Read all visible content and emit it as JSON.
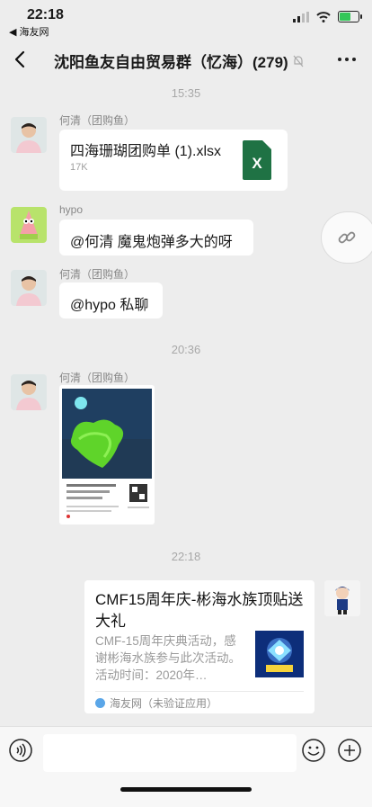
{
  "status": {
    "time": "22:18",
    "back_app": "◀ 海友网"
  },
  "nav": {
    "title": "沈阳鱼友自由贸易群（忆海）(279)"
  },
  "messages": {
    "ts1": "15:35",
    "ts2": "20:36",
    "ts3": "22:18",
    "m1_sender": "何清（团购鱼）",
    "m1_file_name": "四海珊瑚团购单 (1).xlsx",
    "m1_file_size": "17K",
    "m1_file_badge": "X",
    "m2_sender": "hypo",
    "m2_text": "@何清 魔鬼炮弹多大的呀",
    "m3_sender": "何清（团购鱼）",
    "m3_text": "@hypo 私聊",
    "m4_sender": "何清（团购鱼）",
    "card_title": "CMF15周年庆-彬海水族顶贴送大礼",
    "card_desc": "CMF-15周年庆典活动，感谢彬海水族参与此次活动。活动时间：2020年…",
    "card_source": "海友网（未验证应用）"
  },
  "colors": {
    "background": "#ededed",
    "bubble": "#ffffff",
    "excel_green": "#1f7244",
    "timestamp": "#a8a8a8"
  }
}
